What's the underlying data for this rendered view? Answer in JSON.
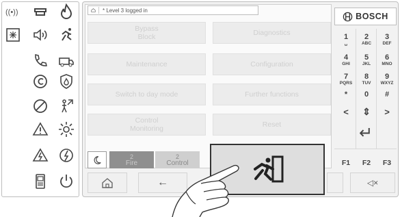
{
  "status_bar": {
    "text": "* Level 3 logged in"
  },
  "menu": [
    {
      "label": "Bypass\nBlock"
    },
    {
      "label": "Diagnostics"
    },
    {
      "label": "Maintenance"
    },
    {
      "label": "Configuration"
    },
    {
      "label": "Switch to day mode"
    },
    {
      "label": "Further functions"
    },
    {
      "label": "Control\nMonitoring"
    },
    {
      "label": "Reset"
    }
  ],
  "counters": [
    {
      "count": "2",
      "label": "Fire",
      "color": "#c0c0c0",
      "bg": "#8f8f8f"
    },
    {
      "count": "2",
      "label": "Control",
      "color": "#888888",
      "bg": "#cfcfcf"
    }
  ],
  "brand": {
    "name": "BOSCH"
  },
  "keypad": [
    {
      "digit": "1",
      "letters": "␣"
    },
    {
      "digit": "2",
      "letters": "ABC"
    },
    {
      "digit": "3",
      "letters": "DEF"
    },
    {
      "digit": "4",
      "letters": "GHI"
    },
    {
      "digit": "5",
      "letters": "JKL"
    },
    {
      "digit": "6",
      "letters": "MNO"
    },
    {
      "digit": "7",
      "letters": "PQRS"
    },
    {
      "digit": "8",
      "letters": "TUV"
    },
    {
      "digit": "9",
      "letters": "WXYZ"
    },
    {
      "digit": "*",
      "letters": ""
    },
    {
      "digit": "0",
      "letters": ""
    },
    {
      "digit": "#",
      "letters": ""
    }
  ],
  "arrows": {
    "left": "<",
    "updown": "⇕",
    "right": ">",
    "enter": "↵"
  },
  "function_keys": [
    "F1",
    "F2",
    "F3"
  ],
  "bottom_bar": {
    "back_arrow": "←",
    "mute": "◁×"
  },
  "icons": {
    "left_strip": [
      "wireless-alarm-icon",
      "siren-icon",
      "fire-flame-icon",
      "panel-icon",
      "speaker-icon",
      "running-exit-icon",
      "phone-icon",
      "fire-truck-icon",
      "copy-c-icon",
      "shield-fire-icon",
      "prohibited-icon",
      "person-test-icon",
      "warning-icon",
      "sun-day-icon",
      "warning-power-icon",
      "power-fault-icon",
      "mobile-device-icon",
      "power-icon"
    ]
  }
}
